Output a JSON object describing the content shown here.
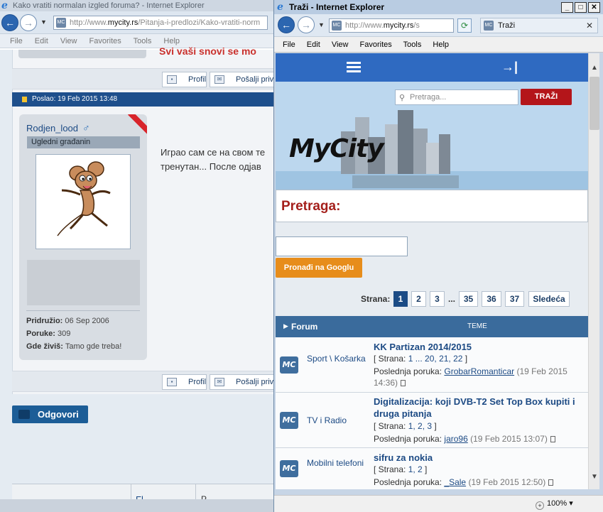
{
  "back_window": {
    "title": "Kako vratiti normalan izgled foruma? - Internet Explorer",
    "url_prefix": "http://www.",
    "url_domain": "mycity.rs",
    "url_path": "/Pitanja-i-predlozi/Kako-vratiti-norm",
    "menu": [
      "File",
      "Edit",
      "View",
      "Favorites",
      "Tools",
      "Help"
    ],
    "partial_title": "Svi vaši snovi se mo",
    "profile_label": "Profil",
    "pm_label": "Pošalji privat",
    "post_header": "Poslao: 19 Feb 2015 13:48",
    "user": {
      "name": "Rodjen_lood",
      "gender_symbol": "♂",
      "rank": "Ugledni građanin",
      "joined_label": "Pridružio:",
      "joined": "06 Sep 2006",
      "posts_label": "Poruke:",
      "posts": "309",
      "location_label": "Gde živiš:",
      "location": "Tamo gde treba!"
    },
    "body_line1": "Играо сам се на свом те",
    "body_line2": "тренутан... После одјав",
    "reply_label": "Odgovori",
    "bottom_cell1": "Fl",
    "bottom_cell2": "P"
  },
  "front_window": {
    "title": "Traži - Internet Explorer",
    "url_prefix": "http://www.",
    "url_domain": "mycity.rs",
    "url_path": "/s",
    "tab_title": "Traži",
    "menu": [
      "File",
      "Edit",
      "View",
      "Favorites",
      "Tools",
      "Help"
    ],
    "search_placeholder": "Pretraga...",
    "search_button": "TRAŽI",
    "logo_text": "MyCity",
    "section_title": "Pretraga:",
    "google_button": "Pronađi na Googlu",
    "pager": {
      "label": "Strana:",
      "pages": [
        "1",
        "2",
        "3"
      ],
      "dots": "...",
      "pages_end": [
        "35",
        "36",
        "37"
      ],
      "next": "Sledeća"
    },
    "forum_header": {
      "forum": "Forum",
      "teme": "TEME"
    },
    "topics": [
      {
        "category": "Sport \\ Košarka",
        "title": "KK Partizan 2014/2015",
        "pages_prefix": "[ Strana: ",
        "pages": "1 ... 20, 21, 22",
        "pages_suffix": " ]",
        "last_label": "Poslednja poruka: ",
        "last_user": "GrobarRomanticar",
        "last_date": "(19 Feb 2015 14:36)"
      },
      {
        "category": "TV i Radio",
        "title": "Digitalizacija: koji DVB-T2 Set Top Box kupiti i druga pitanja",
        "pages_prefix": "[ Strana: ",
        "pages": "1, 2, 3",
        "pages_suffix": " ]",
        "last_label": "Poslednja poruka: ",
        "last_user": "jaro96",
        "last_date": "(19 Feb 2015 13:07)"
      },
      {
        "category": "Mobilni telefoni",
        "title": "sifru za nokia",
        "pages_prefix": "[ Strana: ",
        "pages": "1, 2",
        "pages_suffix": " ]",
        "last_label": "Poslednja poruka: ",
        "last_user": "_Sale",
        "last_date": "(19 Feb 2015 12:50)"
      }
    ],
    "zoom": "100%",
    "mc_badge": "MC"
  }
}
